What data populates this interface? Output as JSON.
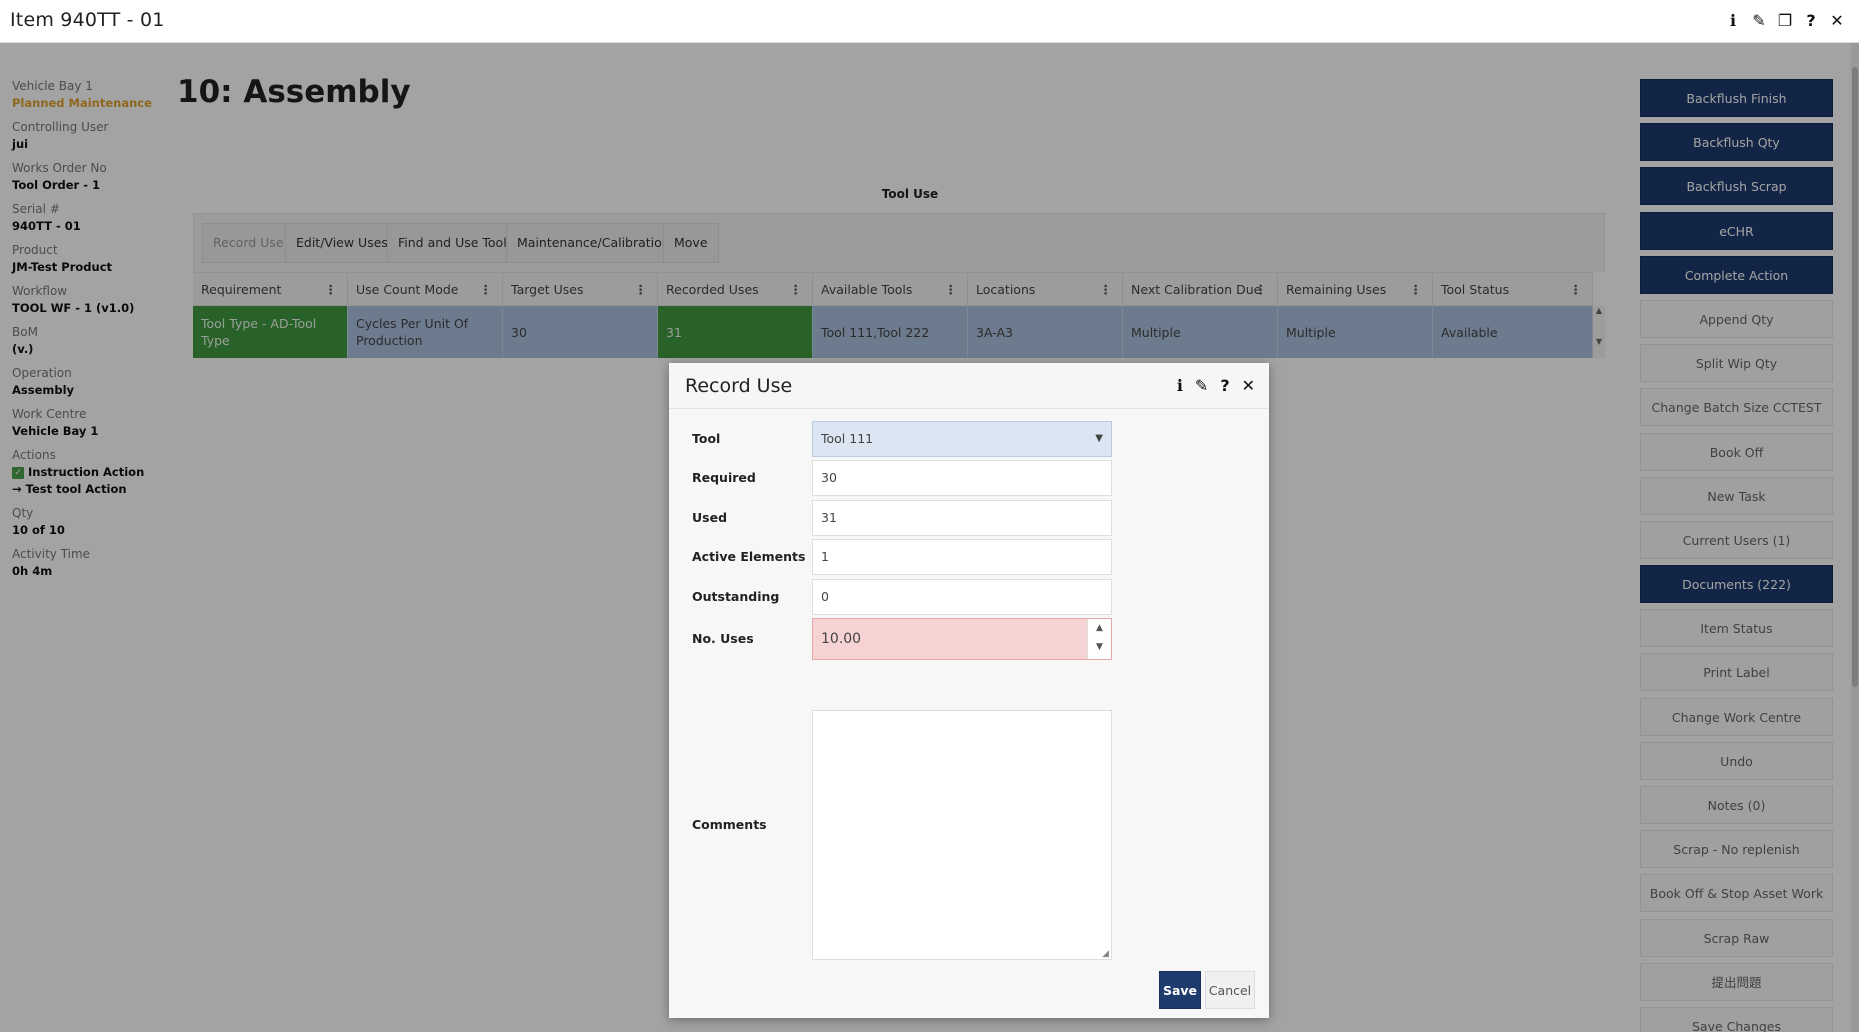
{
  "window": {
    "title": "Item 940TT - 01",
    "tools": [
      "info-icon",
      "pencil-icon",
      "restore-icon",
      "help-icon",
      "close-icon"
    ],
    "tool_glyphs": [
      "ℹ",
      "✎",
      "❐",
      "?",
      "✕"
    ]
  },
  "sidebar": {
    "fields": [
      {
        "label": "Vehicle Bay 1",
        "value": "Planned Maintenance",
        "style": "warn"
      },
      {
        "label": "Controlling User",
        "value": "jui"
      },
      {
        "label": "Works Order No",
        "value": "Tool Order - 1"
      },
      {
        "label": "Serial #",
        "value": "940TT - 01"
      },
      {
        "label": "Product",
        "value": "JM-Test Product"
      },
      {
        "label": "Workflow",
        "value": "TOOL WF - 1 (v1.0)"
      },
      {
        "label": "BoM",
        "value": "(v.)"
      },
      {
        "label": "Operation",
        "value": "Assembly"
      },
      {
        "label": "Work Centre",
        "value": "Vehicle Bay 1"
      }
    ],
    "actions_label": "Actions",
    "actions": [
      {
        "label": "Instruction Action",
        "icon": "check-icon",
        "glyph": "✓"
      },
      {
        "label": "Test tool Action",
        "icon": "arrow-right-icon",
        "glyph": "→"
      }
    ],
    "qty_label": "Qty",
    "qty_value": "10 of 10",
    "activity_label": "Activity Time",
    "activity_value": "0h 4m"
  },
  "main": {
    "page_title": "10: Assembly",
    "panel_title": "Tool Use",
    "toolbar": [
      "Record Use",
      "Edit/View Uses",
      "Find and Use Tool",
      "Maintenance/Calibration",
      "Move"
    ],
    "columns": [
      "Requirement",
      "Use Count Mode",
      "Target Uses",
      "Recorded Uses",
      "Available Tools",
      "Locations",
      "Next Calibration Due",
      "Remaining Uses",
      "Tool Status"
    ],
    "row": [
      "Tool Type - AD-Tool Type",
      "Cycles Per Unit Of Production",
      "30",
      "31",
      "Tool 111,Tool 222",
      "3A-A3",
      "Multiple",
      "Multiple",
      "Available"
    ]
  },
  "right_panel": [
    {
      "label": "Backflush Finish",
      "dark": true
    },
    {
      "label": "Backflush Qty",
      "dark": true
    },
    {
      "label": "Backflush Scrap",
      "dark": true
    },
    {
      "label": "eCHR",
      "dark": true
    },
    {
      "label": "Complete Action",
      "dark": true
    },
    {
      "label": "Append Qty",
      "dark": false
    },
    {
      "label": "Split Wip Qty",
      "dark": false
    },
    {
      "label": "Change Batch Size CCTEST",
      "dark": false
    },
    {
      "label": "Book Off",
      "dark": false
    },
    {
      "label": "New Task",
      "dark": false
    },
    {
      "label": "Current Users (1)",
      "dark": false
    },
    {
      "label": "Documents (222)",
      "dark": true
    },
    {
      "label": "Item Status",
      "dark": false
    },
    {
      "label": "Print Label",
      "dark": false
    },
    {
      "label": "Change Work Centre",
      "dark": false
    },
    {
      "label": "Undo",
      "dark": false
    },
    {
      "label": "Notes (0)",
      "dark": false
    },
    {
      "label": "Scrap - No replenish",
      "dark": false
    },
    {
      "label": "Book Off & Stop Asset Work",
      "dark": false
    },
    {
      "label": "Scrap Raw",
      "dark": false
    },
    {
      "label": "提出問題",
      "dark": false
    },
    {
      "label": "Save Changes",
      "dark": false
    }
  ],
  "modal": {
    "title": "Record Use",
    "tools": [
      "info-icon",
      "pencil-icon",
      "help-icon",
      "close-icon"
    ],
    "tool_glyphs": [
      "ℹ",
      "✎",
      "?",
      "✕"
    ],
    "fields": {
      "tool_label": "Tool",
      "tool_value": "Tool 111",
      "required_label": "Required",
      "required_value": "30",
      "used_label": "Used",
      "used_value": "31",
      "active_label": "Active Elements",
      "active_value": "1",
      "outstanding_label": "Outstanding",
      "outstanding_value": "0",
      "uses_label": "No. Uses",
      "uses_value": "10.00",
      "comments_label": "Comments",
      "comments_value": ""
    },
    "save_label": "Save",
    "cancel_label": "Cancel"
  },
  "colors": {
    "primary_button": "#1e3b6e",
    "green_cell": "#3f9a3f",
    "row_highlight": "#a9c1dd",
    "warning_text": "#e2a12f",
    "error_field": "#f7d2d3"
  }
}
